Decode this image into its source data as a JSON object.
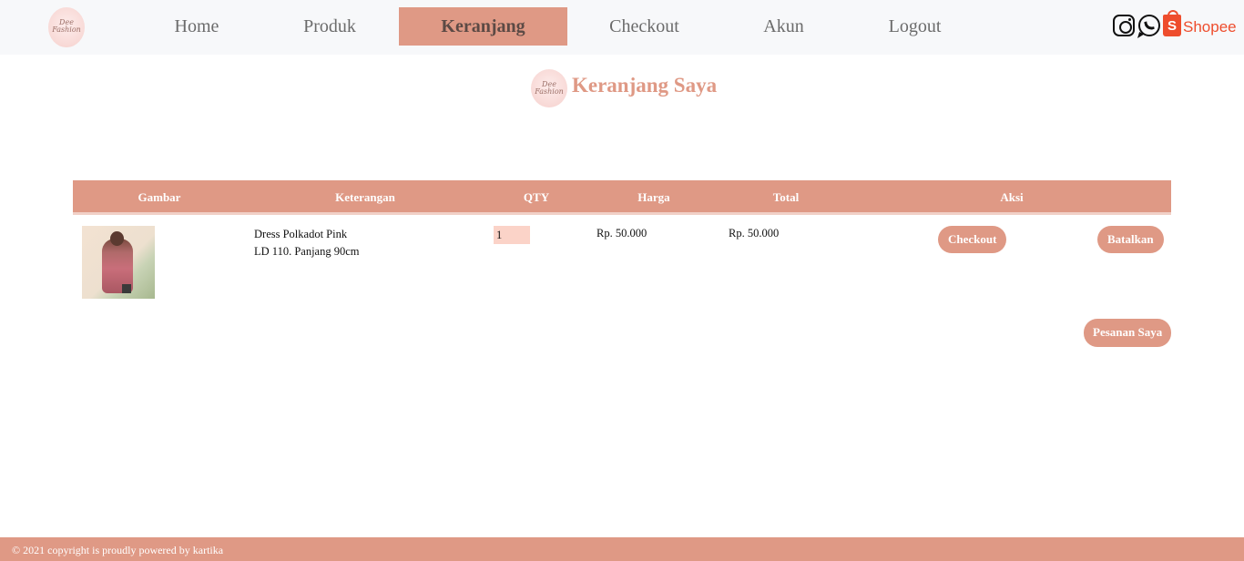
{
  "brand": {
    "logo_text_1": "Dee",
    "logo_text_2": "Fashion"
  },
  "nav": {
    "items": [
      {
        "label": "Home"
      },
      {
        "label": "Produk"
      },
      {
        "label": "Keranjang",
        "active": true
      },
      {
        "label": "Checkout"
      },
      {
        "label": "Akun"
      },
      {
        "label": "Logout"
      }
    ]
  },
  "social": {
    "instagram_icon": "instagram-icon",
    "whatsapp_icon": "whatsapp-icon",
    "shopee_bag": "S",
    "shopee_label": "Shopee"
  },
  "page": {
    "title": "Keranjang Saya"
  },
  "table": {
    "headers": [
      "Gambar",
      "Keterangan",
      "QTY",
      "Harga",
      "Total",
      "Aksi"
    ],
    "rows": [
      {
        "name": "Dress Polkadot Pink",
        "detail": "LD 110. Panjang 90cm",
        "qty": "1",
        "price": "Rp. 50.000",
        "total": "Rp. 50.000",
        "checkout_label": "Checkout",
        "cancel_label": "Batalkan"
      }
    ]
  },
  "orders_button": "Pesanan Saya",
  "footer": {
    "text": "© 2021 copyright is proudly powered by kartika"
  },
  "colors": {
    "accent": "#df9985",
    "navbar_bg": "#f7f8fa",
    "qty_bg": "#fbd3c8",
    "shopee": "#ee4d2d"
  }
}
